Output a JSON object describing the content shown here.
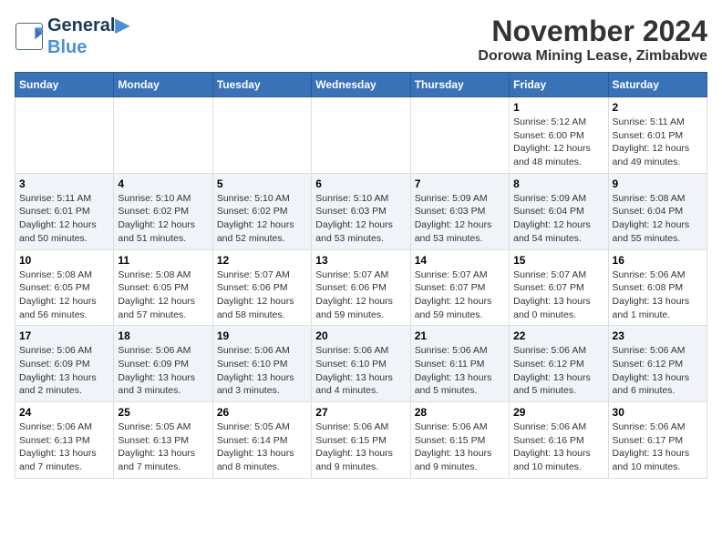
{
  "logo": {
    "line1": "General",
    "line2": "Blue"
  },
  "title": "November 2024",
  "subtitle": "Dorowa Mining Lease, Zimbabwe",
  "days_of_week": [
    "Sunday",
    "Monday",
    "Tuesday",
    "Wednesday",
    "Thursday",
    "Friday",
    "Saturday"
  ],
  "weeks": [
    {
      "alt": false,
      "days": [
        {
          "num": "",
          "info": ""
        },
        {
          "num": "",
          "info": ""
        },
        {
          "num": "",
          "info": ""
        },
        {
          "num": "",
          "info": ""
        },
        {
          "num": "",
          "info": ""
        },
        {
          "num": "1",
          "info": "Sunrise: 5:12 AM\nSunset: 6:00 PM\nDaylight: 12 hours and 48 minutes."
        },
        {
          "num": "2",
          "info": "Sunrise: 5:11 AM\nSunset: 6:01 PM\nDaylight: 12 hours and 49 minutes."
        }
      ]
    },
    {
      "alt": true,
      "days": [
        {
          "num": "3",
          "info": "Sunrise: 5:11 AM\nSunset: 6:01 PM\nDaylight: 12 hours and 50 minutes."
        },
        {
          "num": "4",
          "info": "Sunrise: 5:10 AM\nSunset: 6:02 PM\nDaylight: 12 hours and 51 minutes."
        },
        {
          "num": "5",
          "info": "Sunrise: 5:10 AM\nSunset: 6:02 PM\nDaylight: 12 hours and 52 minutes."
        },
        {
          "num": "6",
          "info": "Sunrise: 5:10 AM\nSunset: 6:03 PM\nDaylight: 12 hours and 53 minutes."
        },
        {
          "num": "7",
          "info": "Sunrise: 5:09 AM\nSunset: 6:03 PM\nDaylight: 12 hours and 53 minutes."
        },
        {
          "num": "8",
          "info": "Sunrise: 5:09 AM\nSunset: 6:04 PM\nDaylight: 12 hours and 54 minutes."
        },
        {
          "num": "9",
          "info": "Sunrise: 5:08 AM\nSunset: 6:04 PM\nDaylight: 12 hours and 55 minutes."
        }
      ]
    },
    {
      "alt": false,
      "days": [
        {
          "num": "10",
          "info": "Sunrise: 5:08 AM\nSunset: 6:05 PM\nDaylight: 12 hours and 56 minutes."
        },
        {
          "num": "11",
          "info": "Sunrise: 5:08 AM\nSunset: 6:05 PM\nDaylight: 12 hours and 57 minutes."
        },
        {
          "num": "12",
          "info": "Sunrise: 5:07 AM\nSunset: 6:06 PM\nDaylight: 12 hours and 58 minutes."
        },
        {
          "num": "13",
          "info": "Sunrise: 5:07 AM\nSunset: 6:06 PM\nDaylight: 12 hours and 59 minutes."
        },
        {
          "num": "14",
          "info": "Sunrise: 5:07 AM\nSunset: 6:07 PM\nDaylight: 12 hours and 59 minutes."
        },
        {
          "num": "15",
          "info": "Sunrise: 5:07 AM\nSunset: 6:07 PM\nDaylight: 13 hours and 0 minutes."
        },
        {
          "num": "16",
          "info": "Sunrise: 5:06 AM\nSunset: 6:08 PM\nDaylight: 13 hours and 1 minute."
        }
      ]
    },
    {
      "alt": true,
      "days": [
        {
          "num": "17",
          "info": "Sunrise: 5:06 AM\nSunset: 6:09 PM\nDaylight: 13 hours and 2 minutes."
        },
        {
          "num": "18",
          "info": "Sunrise: 5:06 AM\nSunset: 6:09 PM\nDaylight: 13 hours and 3 minutes."
        },
        {
          "num": "19",
          "info": "Sunrise: 5:06 AM\nSunset: 6:10 PM\nDaylight: 13 hours and 3 minutes."
        },
        {
          "num": "20",
          "info": "Sunrise: 5:06 AM\nSunset: 6:10 PM\nDaylight: 13 hours and 4 minutes."
        },
        {
          "num": "21",
          "info": "Sunrise: 5:06 AM\nSunset: 6:11 PM\nDaylight: 13 hours and 5 minutes."
        },
        {
          "num": "22",
          "info": "Sunrise: 5:06 AM\nSunset: 6:12 PM\nDaylight: 13 hours and 5 minutes."
        },
        {
          "num": "23",
          "info": "Sunrise: 5:06 AM\nSunset: 6:12 PM\nDaylight: 13 hours and 6 minutes."
        }
      ]
    },
    {
      "alt": false,
      "days": [
        {
          "num": "24",
          "info": "Sunrise: 5:06 AM\nSunset: 6:13 PM\nDaylight: 13 hours and 7 minutes."
        },
        {
          "num": "25",
          "info": "Sunrise: 5:05 AM\nSunset: 6:13 PM\nDaylight: 13 hours and 7 minutes."
        },
        {
          "num": "26",
          "info": "Sunrise: 5:05 AM\nSunset: 6:14 PM\nDaylight: 13 hours and 8 minutes."
        },
        {
          "num": "27",
          "info": "Sunrise: 5:06 AM\nSunset: 6:15 PM\nDaylight: 13 hours and 9 minutes."
        },
        {
          "num": "28",
          "info": "Sunrise: 5:06 AM\nSunset: 6:15 PM\nDaylight: 13 hours and 9 minutes."
        },
        {
          "num": "29",
          "info": "Sunrise: 5:06 AM\nSunset: 6:16 PM\nDaylight: 13 hours and 10 minutes."
        },
        {
          "num": "30",
          "info": "Sunrise: 5:06 AM\nSunset: 6:17 PM\nDaylight: 13 hours and 10 minutes."
        }
      ]
    }
  ]
}
